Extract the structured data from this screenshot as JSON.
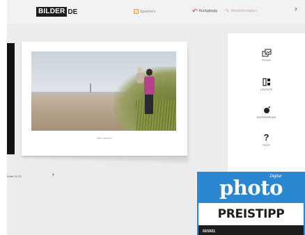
{
  "header": {
    "logo_main": "BILDER",
    "logo_ext": "DE",
    "save_label": "Speichern",
    "undo_label": "Rückgängig",
    "redo_label": "Wiederherstellen",
    "help_label": "?"
  },
  "book": {
    "caption": "Bier Kachler"
  },
  "pager": {
    "label": "Seite 22-23",
    "arrow": "›"
  },
  "tools": {
    "fotos": "FOTOS",
    "layouts": "LAYOUTS",
    "background": "HINTERGRUND",
    "help_q": "?",
    "help": "HILFE"
  },
  "badge": {
    "digital": "Digital",
    "photo": "photo",
    "tipp": "PREISTIPP",
    "issue": "02/2021"
  },
  "colors": {
    "badge_blue": "#2b87cf",
    "undo_red": "#d9302c",
    "save_orange": "#e9a132"
  }
}
